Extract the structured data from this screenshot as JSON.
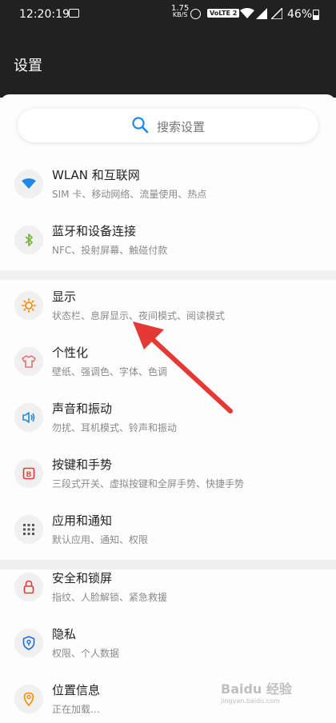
{
  "status_bar": {
    "time": "12:20:19",
    "net_speed": "1.75",
    "net_unit": "KB/S",
    "volte": "VoLTE 2",
    "battery": "46%"
  },
  "header": {
    "title": "设置"
  },
  "search": {
    "placeholder": "搜索设置"
  },
  "settings": [
    {
      "title": "WLAN 和互联网",
      "subtitle": "SIM 卡、移动网络、流量使用、热点",
      "icon": "wifi-icon",
      "color": "#1e88e5"
    },
    {
      "title": "蓝牙和设备连接",
      "subtitle": "NFC、投射屏幕、触碰付款",
      "icon": "bluetooth-icon",
      "color": "#7cb342"
    },
    {
      "title": "显示",
      "subtitle": "状态栏、息屏显示、夜间模式、阅读模式",
      "icon": "brightness-icon",
      "color": "#fb8c00"
    },
    {
      "title": "个性化",
      "subtitle": "壁纸、强调色、字体、色调",
      "icon": "shirt-icon",
      "color": "#e57373"
    },
    {
      "title": "声音和振动",
      "subtitle": "勿扰、耳机模式、铃声和振动",
      "icon": "speaker-icon",
      "color": "#1e88e5"
    },
    {
      "title": "按键和手势",
      "subtitle": "三段式开关、虚拟按键和全屏手势、快捷手势",
      "icon": "button-icon",
      "color": "#e53935"
    },
    {
      "title": "应用和通知",
      "subtitle": "默认应用、通知、权限",
      "icon": "apps-grid-icon",
      "color": "#555555"
    },
    {
      "title": "安全和锁屏",
      "subtitle": "指纹、人脸解锁、紧急救援",
      "icon": "lock-icon",
      "color": "#e53935"
    },
    {
      "title": "隐私",
      "subtitle": "权限、个人数据",
      "icon": "shield-icon",
      "color": "#1e6fd9"
    },
    {
      "title": "位置信息",
      "subtitle": "正在加载…",
      "icon": "location-icon",
      "color": "#fb8c00"
    }
  ],
  "watermark": {
    "brand": "Baidu 经验",
    "url": "jingyan.baidu.com"
  },
  "annotation": {
    "color": "#e53935"
  }
}
